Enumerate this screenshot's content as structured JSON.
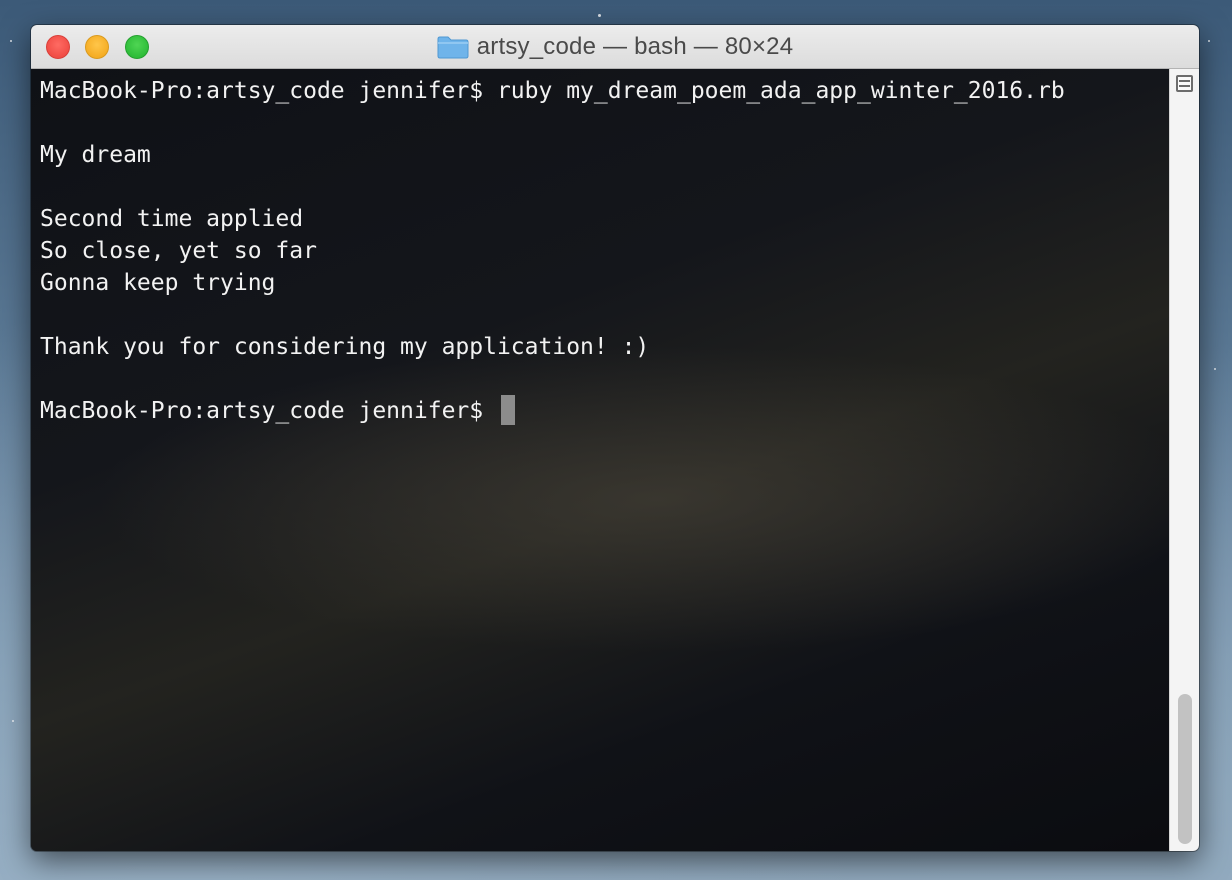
{
  "window": {
    "title": "artsy_code — bash — 80×24",
    "folder_icon": "folder-icon"
  },
  "terminal": {
    "lines": [
      "MacBook-Pro:artsy_code jennifer$ ruby my_dream_poem_ada_app_winter_2016.rb",
      "",
      "My dream",
      "",
      "Second time applied",
      "So close, yet so far",
      "Gonna keep trying",
      "",
      "Thank you for considering my application! :)",
      "",
      "MacBook-Pro:artsy_code jennifer$ "
    ],
    "text_color": "#f2f2f2"
  },
  "colors": {
    "close": "#f14d46",
    "minimize": "#f5ad25",
    "maximize": "#2ebd39",
    "folder": "#6fb4ea"
  }
}
